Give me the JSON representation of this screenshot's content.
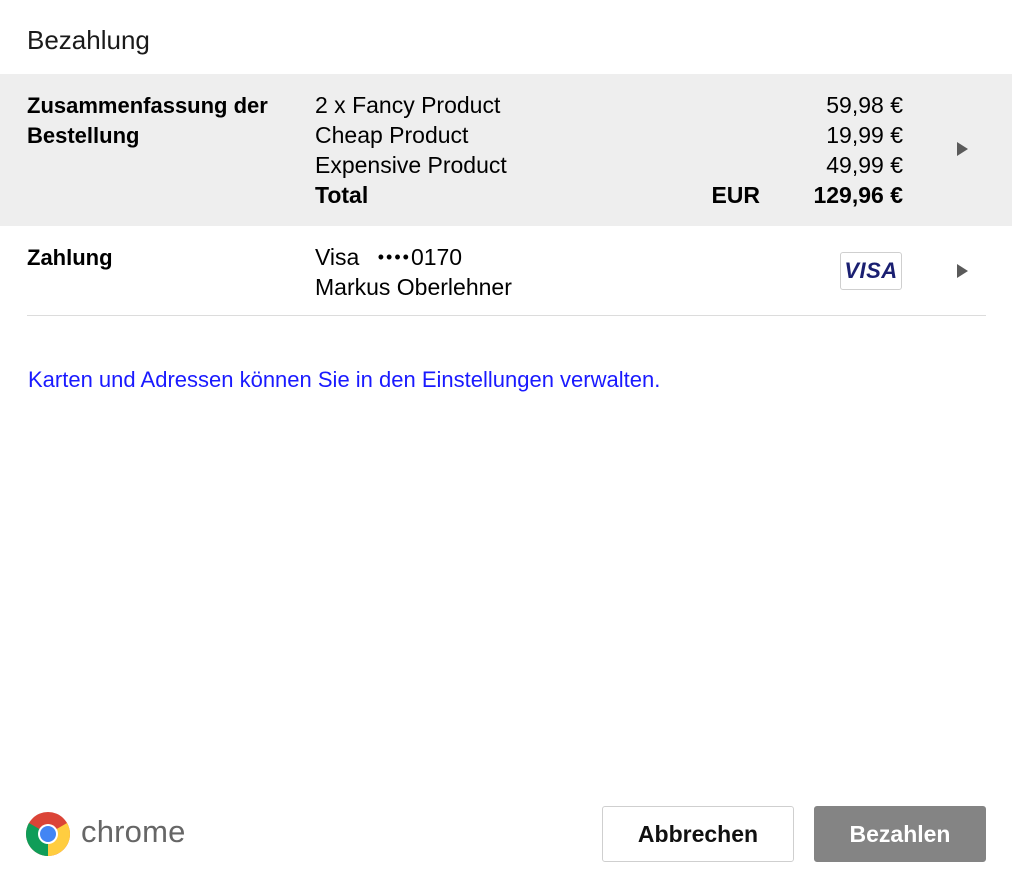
{
  "dialog": {
    "title": "Bezahlung"
  },
  "order_summary": {
    "label": "Zusammenfassung der Bestellung",
    "items": [
      {
        "name": "2 x Fancy Product",
        "price": "59,98 €"
      },
      {
        "name": "Cheap Product",
        "price": "19,99 €"
      },
      {
        "name": "Expensive Product",
        "price": "49,99 €"
      }
    ],
    "total_label": "Total",
    "total_currency": "EUR",
    "total_amount": "129,96 €"
  },
  "payment": {
    "label": "Zahlung",
    "card_type": "Visa",
    "card_mask": "••••",
    "card_last_digits": "0170",
    "cardholder": "Markus Oberlehner",
    "card_brand_badge": "VISA",
    "card_brand_color": "#1a1f71"
  },
  "settings_link": "Karten und Adressen können Sie in den Einstellungen verwalten.",
  "footer": {
    "brand_icon": "chrome-logo-icon",
    "brand_name": "chrome",
    "cancel_label": "Abbrechen",
    "pay_label": "Bezahlen"
  },
  "colors": {
    "summary_background": "#eeeeee",
    "link": "#1a1aff",
    "pay_button": "#848484"
  }
}
